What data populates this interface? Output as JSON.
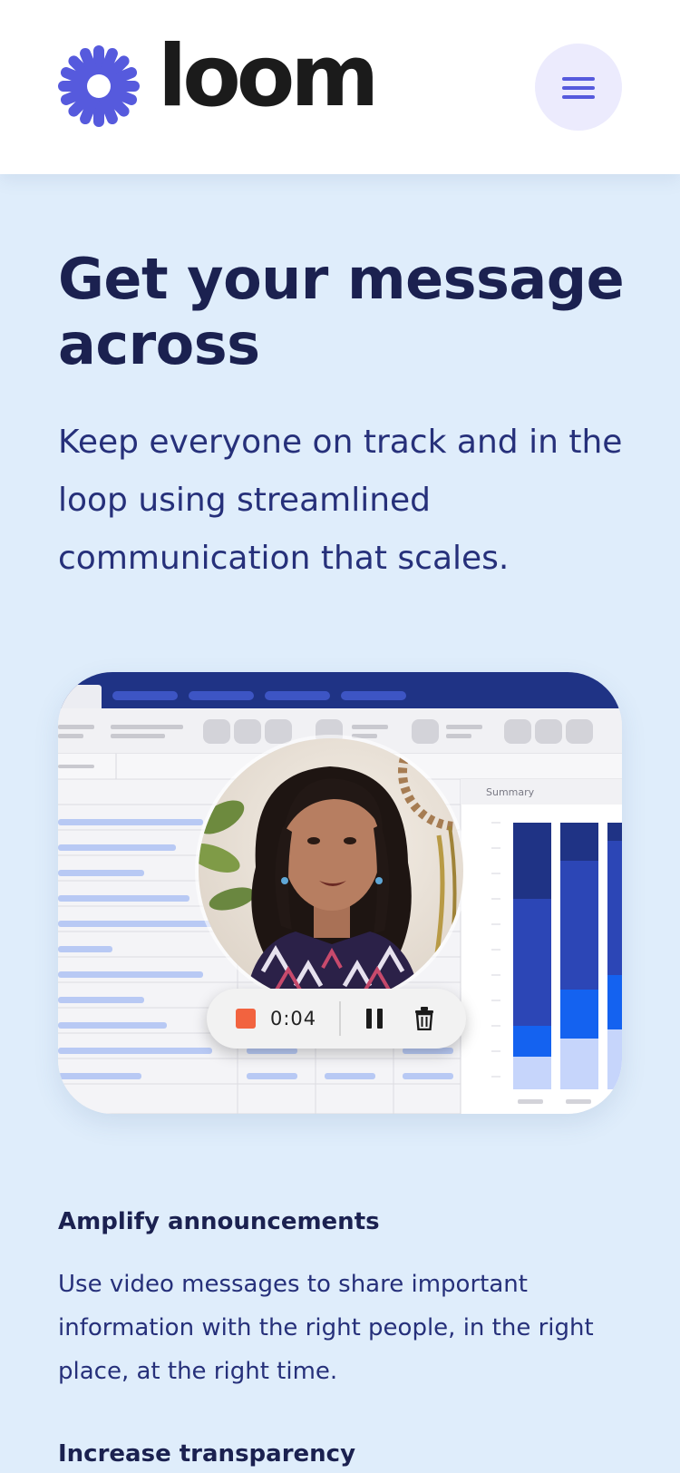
{
  "brand": {
    "name": "loom",
    "logo_icon": "loom-starburst-icon",
    "color": "#565add"
  },
  "header": {
    "menu_icon": "hamburger-menu-icon"
  },
  "hero": {
    "title": "Get your message across",
    "subtitle": "Keep everyone on track and in the loop using streamlined communication that scales."
  },
  "illustration": {
    "panel_label": "Summary",
    "recording": {
      "time": "0:04",
      "stop_icon": "stop-icon",
      "pause_icon": "pause-icon",
      "delete_icon": "trash-icon"
    }
  },
  "features": [
    {
      "title": "Amplify announcements",
      "text": "Use video messages to share important information with the right people, in the right place, at the right time."
    },
    {
      "title": "Increase transparency"
    }
  ],
  "colors": {
    "page_bg": "#dfedfb",
    "heading": "#1b2150",
    "body_text": "#26307a",
    "record": "#f2633f"
  }
}
